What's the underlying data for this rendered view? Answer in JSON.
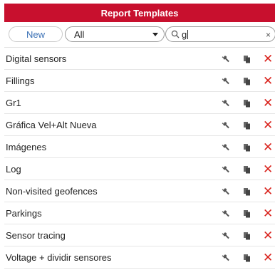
{
  "header": {
    "title": "Report Templates"
  },
  "toolbar": {
    "new_label": "New",
    "filter_value": "All",
    "search_value": "g"
  },
  "rows": [
    {
      "name": "Digital sensors"
    },
    {
      "name": "Fillings"
    },
    {
      "name": "Gr1"
    },
    {
      "name": "Gráfica Vel+Alt Nueva"
    },
    {
      "name": "Imágenes"
    },
    {
      "name": "Log"
    },
    {
      "name": "Non-visited geofences"
    },
    {
      "name": "Parkings"
    },
    {
      "name": "Sensor tracing"
    },
    {
      "name": "Voltage + dividir sensores"
    }
  ],
  "icons": {
    "edit": "wrench-icon",
    "copy": "copy-icon",
    "delete": "close-icon"
  },
  "colors": {
    "accent": "#c8102e",
    "delete": "#d9231d",
    "link": "#3a70b5"
  }
}
